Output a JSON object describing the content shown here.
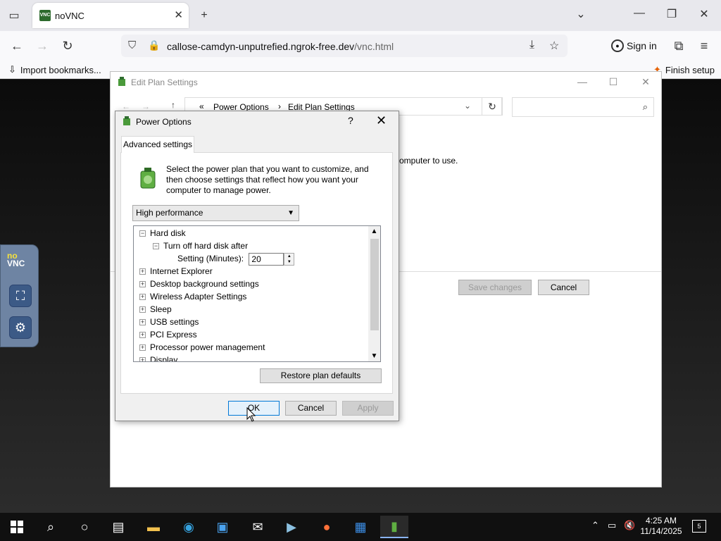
{
  "browser": {
    "tab_title": "noVNC",
    "new_tab": "+",
    "url_host": "callose-camdyn-unputrefied.ngrok-free.dev",
    "url_path": "/vnc.html",
    "sign_in": "Sign in",
    "bookmarks": {
      "import": "Import bookmarks...",
      "finish_setup": "Finish setup"
    }
  },
  "novnc": {
    "logo_top": "no",
    "logo_bottom": "VNC"
  },
  "edit_plan": {
    "title": "Edit Plan Settings",
    "crumb_root": "«",
    "crumb_1": "Power Options",
    "crumb_sep": "›",
    "crumb_2": "Edit Plan Settings",
    "body_text": "omputer to use.",
    "save_changes": "Save changes",
    "cancel": "Cancel"
  },
  "dialog": {
    "title": "Power Options",
    "help": "?",
    "close": "✕",
    "tab": "Advanced settings",
    "intro": "Select the power plan that you want to customize, and then choose settings that reflect how you want your computer to manage power.",
    "plan_selected": "High performance",
    "tree": [
      {
        "label": "Hard disk",
        "expander": "−"
      },
      {
        "label": "Turn off hard disk after",
        "expander": "−"
      },
      {
        "label": "Setting (Minutes):",
        "value": "20"
      },
      {
        "label": "Internet Explorer",
        "expander": "+"
      },
      {
        "label": "Desktop background settings",
        "expander": "+"
      },
      {
        "label": "Wireless Adapter Settings",
        "expander": "+"
      },
      {
        "label": "Sleep",
        "expander": "+"
      },
      {
        "label": "USB settings",
        "expander": "+"
      },
      {
        "label": "PCI Express",
        "expander": "+"
      },
      {
        "label": "Processor power management",
        "expander": "+"
      },
      {
        "label": "Display",
        "expander": "+"
      }
    ],
    "restore": "Restore plan defaults",
    "ok": "OK",
    "cancel": "Cancel",
    "apply": "Apply"
  },
  "taskbar": {
    "time": "4:25 AM",
    "date": "11/14/2025",
    "notifications": "5"
  }
}
